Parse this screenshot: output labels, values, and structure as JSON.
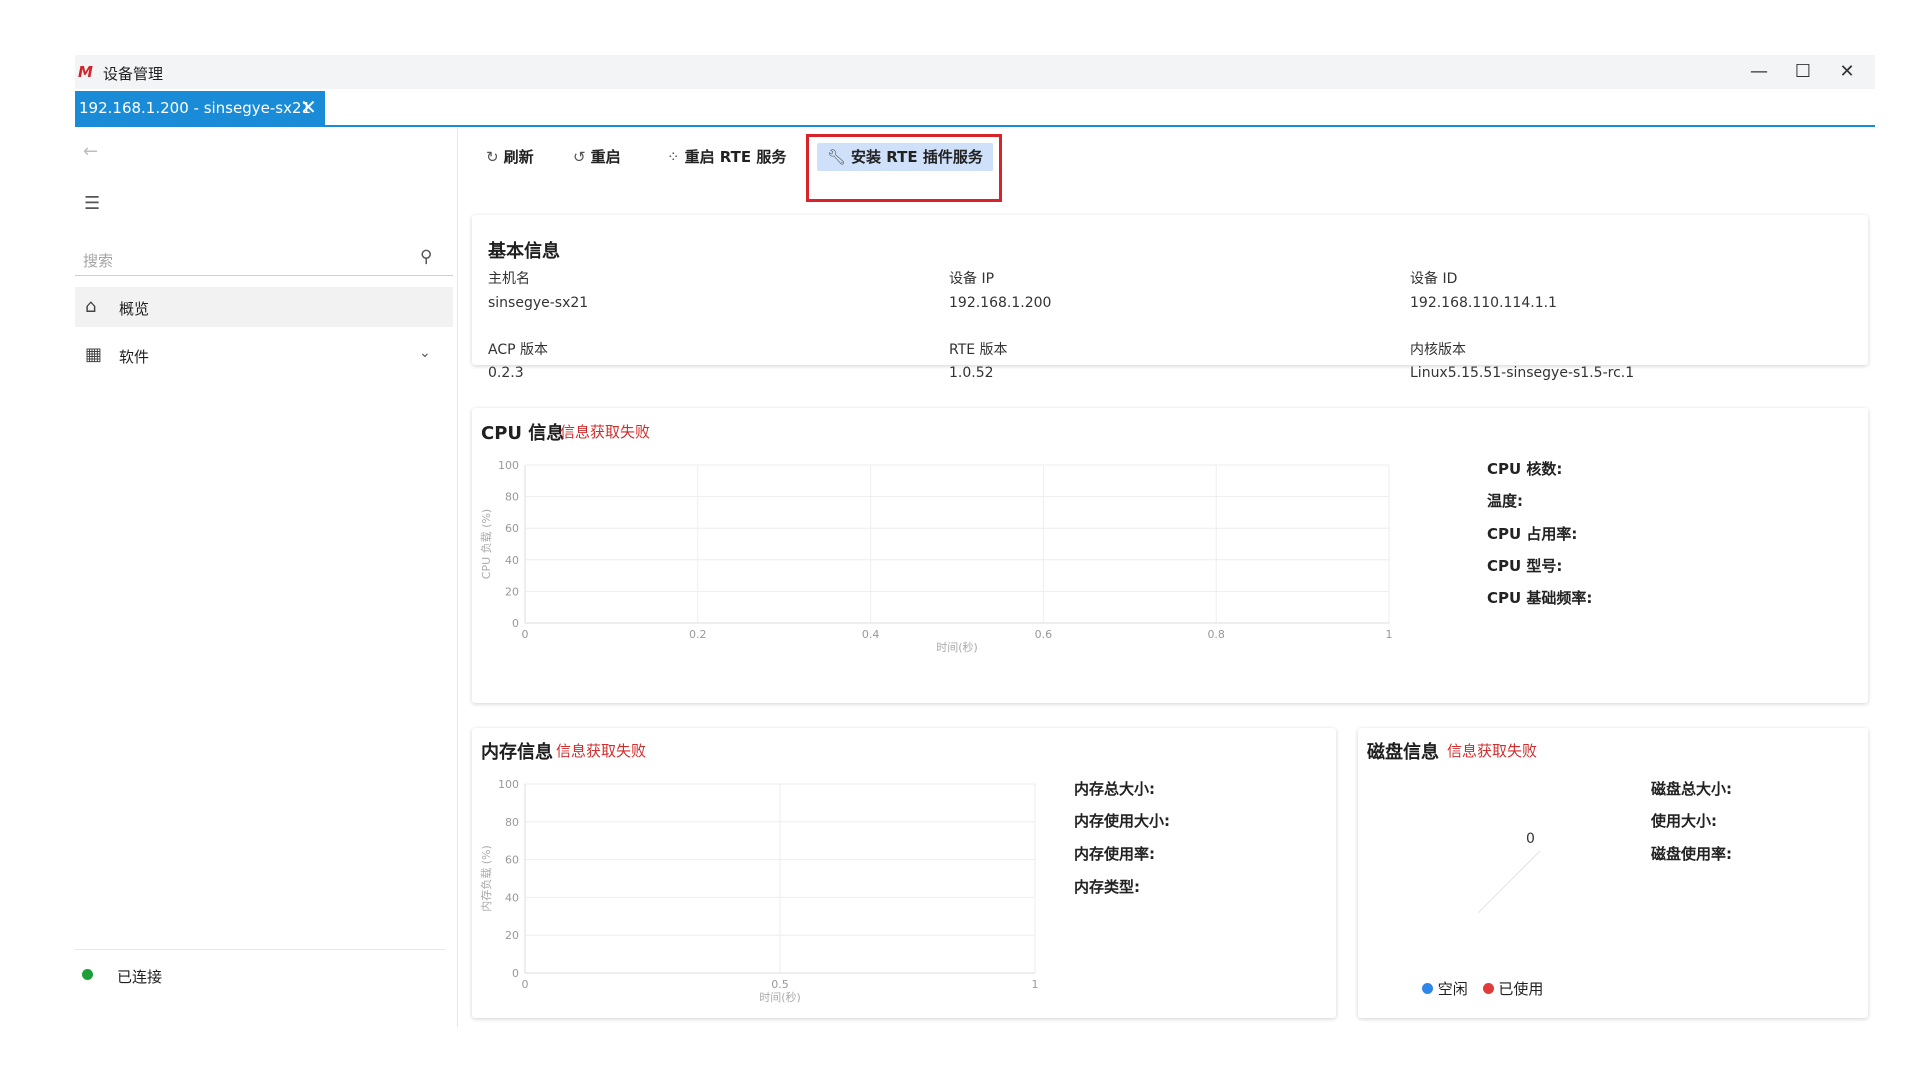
{
  "window": {
    "title": "设备管理",
    "logo": "M",
    "controls": {
      "minimize": "—",
      "maximize": "☐",
      "close": "✕"
    }
  },
  "tab": {
    "label": "192.168.1.200 - sinsegye-sx21",
    "close": "✕"
  },
  "sidebar": {
    "search_placeholder": "搜索",
    "items": [
      {
        "label": "概览",
        "icon": "home-icon"
      },
      {
        "label": "软件",
        "icon": "grid-icon"
      }
    ],
    "status": "已连接"
  },
  "toolbar": {
    "refresh": "刷新",
    "restart": "重启",
    "restart_rte": "重启 RTE 服务",
    "install_rte_plugin": "安装 RTE 插件服务"
  },
  "basic_info": {
    "title": "基本信息",
    "fields": [
      {
        "label": "主机名",
        "value": "sinsegye-sx21"
      },
      {
        "label": "设备 IP",
        "value": "192.168.1.200"
      },
      {
        "label": "设备 ID",
        "value": "192.168.110.114.1.1"
      },
      {
        "label": "ACP 版本",
        "value": "0.2.3"
      },
      {
        "label": "RTE 版本",
        "value": "1.0.52"
      },
      {
        "label": "内核版本",
        "value": "Linux5.15.51-sinsegye-s1.5-rc.1"
      }
    ]
  },
  "cpu": {
    "title": "CPU 信息",
    "error": "信息获取失败",
    "stats": [
      "CPU 核数:",
      "温度:",
      "CPU 占用率:",
      "CPU 型号:",
      "CPU 基础频率:"
    ]
  },
  "memory": {
    "title": "内存信息",
    "error": "信息获取失败",
    "stats": [
      "内存总大小:",
      "内存使用大小:",
      "内存使用率:",
      "内存类型:"
    ]
  },
  "disk": {
    "title": "磁盘信息",
    "error": "信息获取失败",
    "stats": [
      "磁盘总大小:",
      "使用大小:",
      "磁盘使用率:"
    ],
    "center_value": "0",
    "legend": [
      {
        "label": "空闲",
        "color": "#2f86e8"
      },
      {
        "label": "已使用",
        "color": "#e03a3a"
      }
    ]
  },
  "chart_data": [
    {
      "type": "line",
      "ylabel": "CPU 负载 (%)",
      "xlabel": "时间(秒)",
      "xlim": [
        0,
        1
      ],
      "ylim": [
        0,
        100
      ],
      "x_ticks": [
        "0",
        "0.2",
        "0.4",
        "0.6",
        "0.8",
        "1"
      ],
      "y_ticks": [
        "0",
        "20",
        "40",
        "60",
        "80",
        "100"
      ],
      "series": [],
      "grid": true
    },
    {
      "type": "line",
      "ylabel": "内存负载 (%)",
      "xlabel": "时间(秒)",
      "xlim": [
        0,
        1
      ],
      "ylim": [
        0,
        100
      ],
      "x_ticks": [
        "0",
        "0.5",
        "1"
      ],
      "y_ticks": [
        "0",
        "20",
        "40",
        "60",
        "80",
        "100"
      ],
      "series": [],
      "grid": true
    }
  ]
}
